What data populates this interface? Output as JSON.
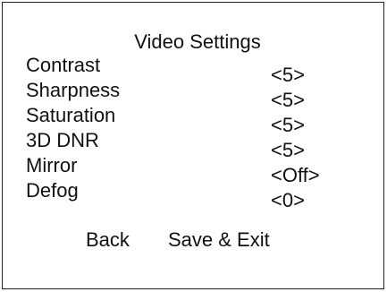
{
  "menu": {
    "title": "Video Settings",
    "items": [
      {
        "label": "Contrast",
        "value": "<5>"
      },
      {
        "label": "Sharpness",
        "value": "<5>"
      },
      {
        "label": "Saturation",
        "value": "<5>"
      },
      {
        "label": "3D DNR",
        "value": "<5>"
      },
      {
        "label": "Mirror",
        "value": "<Off>"
      },
      {
        "label": "Defog",
        "value": "<0>"
      }
    ],
    "back_label": "Back",
    "save_exit_label": "Save & Exit"
  }
}
